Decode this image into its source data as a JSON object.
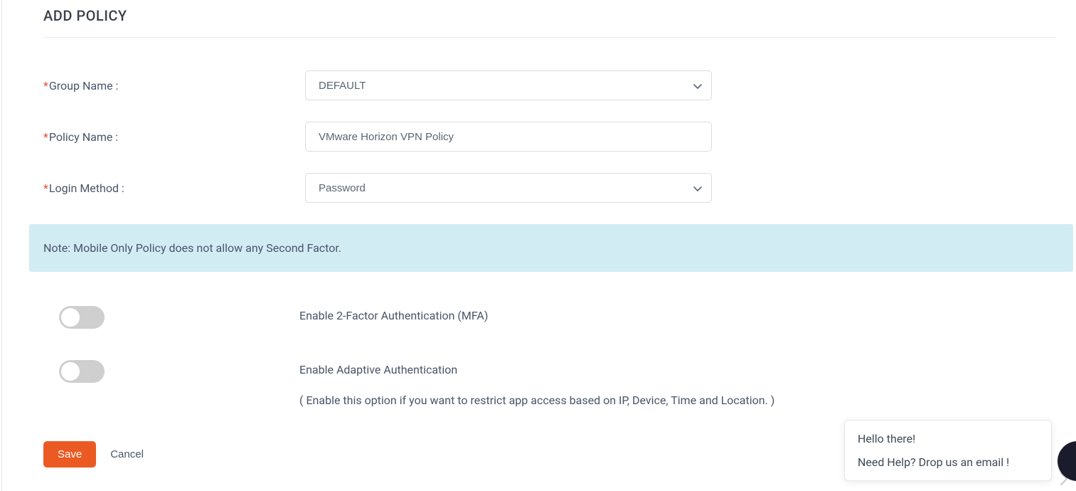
{
  "page": {
    "title": "ADD POLICY"
  },
  "form": {
    "group_name": {
      "label": "Group Name :",
      "selected": "DEFAULT",
      "options": [
        "DEFAULT"
      ]
    },
    "policy_name": {
      "label": "Policy Name :",
      "value": "VMware Horizon VPN Policy"
    },
    "login_method": {
      "label": "Login Method :",
      "selected": "Password",
      "options": [
        "Password"
      ]
    }
  },
  "banner": {
    "note": "Note: Mobile Only Policy does not allow any Second Factor."
  },
  "toggles": {
    "mfa": {
      "label": "Enable 2-Factor Authentication (MFA)",
      "enabled": false
    },
    "adaptive": {
      "label": "Enable Adaptive Authentication",
      "sublabel": "( Enable this option if you want to restrict app access based on IP, Device, Time and Location. )",
      "enabled": false
    }
  },
  "actions": {
    "save": "Save",
    "cancel": "Cancel"
  },
  "help": {
    "line1": "Hello there!",
    "line2": "Need Help? Drop us an email !"
  },
  "colors": {
    "accent": "#ec5a24",
    "banner_bg": "#d2ecf4",
    "text": "#4a5568",
    "asterisk": "#e74c3c"
  }
}
